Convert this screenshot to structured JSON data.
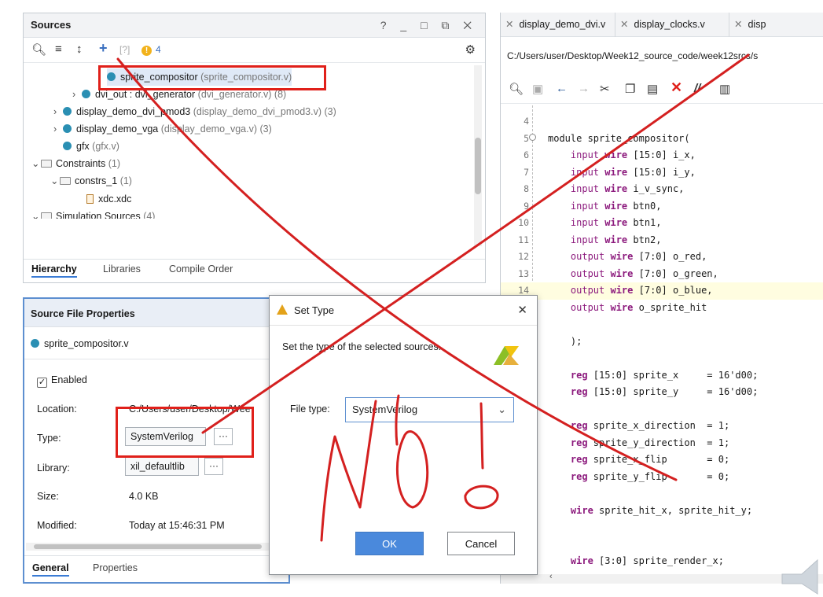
{
  "sources_panel": {
    "title": "Sources",
    "window_controls": "? _ □ ⧉ ✕",
    "warning_count": "4",
    "tree": [
      {
        "name": "sprite_compositor",
        "detail": "(sprite_compositor.v)"
      },
      {
        "name": "dvi_out : dvi_generator",
        "detail": "(dvi_generator.v) (8)"
      },
      {
        "name": "display_demo_dvi_pmod3",
        "detail": "(display_demo_dvi_pmod3.v) (3)"
      },
      {
        "name": "display_demo_vga",
        "detail": "(display_demo_vga.v) (3)"
      },
      {
        "name": "gfx",
        "detail": "(gfx.v)"
      },
      {
        "name": "Constraints",
        "detail": "(1)"
      },
      {
        "name": "constrs_1",
        "detail": "(1)"
      },
      {
        "name": "xdc.xdc",
        "detail": ""
      },
      {
        "name": "Simulation Sources",
        "detail": "(4)"
      }
    ],
    "tabs": [
      "Hierarchy",
      "Libraries",
      "Compile Order"
    ]
  },
  "properties_panel": {
    "title": "Source File Properties",
    "file_name": "sprite_compositor.v",
    "enabled_label": "Enabled",
    "location_label": "Location:",
    "location_value": "C:/Users/user/Desktop/Wee",
    "type_label": "Type:",
    "type_value": "SystemVerilog",
    "library_label": "Library:",
    "library_value": "xil_defaultlib",
    "size_label": "Size:",
    "size_value": "4.0 KB",
    "modified_label": "Modified:",
    "modified_value": "Today at 15:46:31 PM",
    "dots": "···",
    "tabs": [
      "General",
      "Properties"
    ]
  },
  "editor": {
    "tabs": [
      "display_demo_dvi.v",
      "display_clocks.v",
      "disp"
    ],
    "path": "C:/Users/user/Desktop/Week12_source_code/week12srcs/s",
    "lines": [
      {
        "n": "4",
        "parts": []
      },
      {
        "n": "5",
        "parts": [
          {
            "t": "module sprite_compositor(",
            "c": ""
          }
        ]
      },
      {
        "n": "6",
        "parts": [
          {
            "t": "    input ",
            "c": "kw2"
          },
          {
            "t": "wire",
            "c": "kw"
          },
          {
            "t": " [15:0] i_x,",
            "c": ""
          }
        ]
      },
      {
        "n": "7",
        "parts": [
          {
            "t": "    input ",
            "c": "kw2"
          },
          {
            "t": "wire",
            "c": "kw"
          },
          {
            "t": " [15:0] i_y,",
            "c": ""
          }
        ]
      },
      {
        "n": "8",
        "parts": [
          {
            "t": "    input ",
            "c": "kw2"
          },
          {
            "t": "wire",
            "c": "kw"
          },
          {
            "t": " i_v_sync,",
            "c": ""
          }
        ]
      },
      {
        "n": "9",
        "parts": [
          {
            "t": "    input ",
            "c": "kw2"
          },
          {
            "t": "wire",
            "c": "kw"
          },
          {
            "t": " btn0,",
            "c": ""
          }
        ]
      },
      {
        "n": "10",
        "parts": [
          {
            "t": "    input ",
            "c": "kw2"
          },
          {
            "t": "wire",
            "c": "kw"
          },
          {
            "t": " btn1,",
            "c": ""
          }
        ]
      },
      {
        "n": "11",
        "parts": [
          {
            "t": "    input ",
            "c": "kw2"
          },
          {
            "t": "wire",
            "c": "kw"
          },
          {
            "t": " btn2,",
            "c": ""
          }
        ]
      },
      {
        "n": "12",
        "parts": [
          {
            "t": "    output ",
            "c": "kw2"
          },
          {
            "t": "wire",
            "c": "kw"
          },
          {
            "t": " [7:0] o_red,",
            "c": ""
          }
        ]
      },
      {
        "n": "13",
        "parts": [
          {
            "t": "    output ",
            "c": "kw2"
          },
          {
            "t": "wire",
            "c": "kw"
          },
          {
            "t": " [7:0] o_green,",
            "c": ""
          }
        ]
      },
      {
        "n": "14",
        "parts": [
          {
            "t": "    output ",
            "c": "kw2"
          },
          {
            "t": "wire",
            "c": "kw"
          },
          {
            "t": " [7:0] o_blue,",
            "c": ""
          }
        ],
        "hl": true
      },
      {
        "n": "",
        "parts": [
          {
            "t": "    output ",
            "c": "kw2"
          },
          {
            "t": "wire",
            "c": "kw"
          },
          {
            "t": " o_sprite_hit",
            "c": ""
          }
        ]
      },
      {
        "n": "",
        "parts": []
      },
      {
        "n": "",
        "parts": [
          {
            "t": "    );",
            "c": ""
          }
        ]
      },
      {
        "n": "",
        "parts": []
      },
      {
        "n": "",
        "parts": [
          {
            "t": "    reg",
            "c": "kw"
          },
          {
            "t": " [15:0] sprite_x     = 16'd00;",
            "c": ""
          }
        ]
      },
      {
        "n": "",
        "parts": [
          {
            "t": "    reg",
            "c": "kw"
          },
          {
            "t": " [15:0] sprite_y     = 16'd00;",
            "c": ""
          }
        ]
      },
      {
        "n": "",
        "parts": []
      },
      {
        "n": "",
        "parts": [
          {
            "t": "    reg",
            "c": "kw"
          },
          {
            "t": " sprite_x_direction  = 1;",
            "c": ""
          }
        ]
      },
      {
        "n": "",
        "parts": [
          {
            "t": "    reg",
            "c": "kw"
          },
          {
            "t": " sprite_y_direction  = 1;",
            "c": ""
          }
        ]
      },
      {
        "n": "",
        "parts": [
          {
            "t": "    reg",
            "c": "kw"
          },
          {
            "t": " sprite_x_flip       = 0;",
            "c": ""
          }
        ]
      },
      {
        "n": "",
        "parts": [
          {
            "t": "    reg",
            "c": "kw"
          },
          {
            "t": " sprite_y_flip       = 0;",
            "c": ""
          }
        ]
      },
      {
        "n": "",
        "parts": []
      },
      {
        "n": "",
        "parts": [
          {
            "t": "    wire",
            "c": "kw"
          },
          {
            "t": " sprite_hit_x, sprite_hit_y;",
            "c": ""
          }
        ]
      },
      {
        "n": "",
        "parts": []
      },
      {
        "n": "",
        "parts": []
      },
      {
        "n": "",
        "parts": [
          {
            "t": "    wire",
            "c": "kw"
          },
          {
            "t": " [3:0] sprite_render_x;",
            "c": ""
          }
        ]
      }
    ]
  },
  "dialog": {
    "title": "Set Type",
    "message": "Set the type of the selected sources.",
    "file_type_label": "File type:",
    "file_type_value": "SystemVerilog",
    "ok_label": "OK",
    "cancel_label": "Cancel",
    "close": "✕"
  },
  "annotation": {
    "handwritten_text": "No!",
    "color": "#d42020"
  },
  "colors": {
    "accent": "#4a89dc",
    "source_dot": "#2a8fb3",
    "keyword": "#8c1a7d",
    "annotation_red": "#e0201a"
  }
}
